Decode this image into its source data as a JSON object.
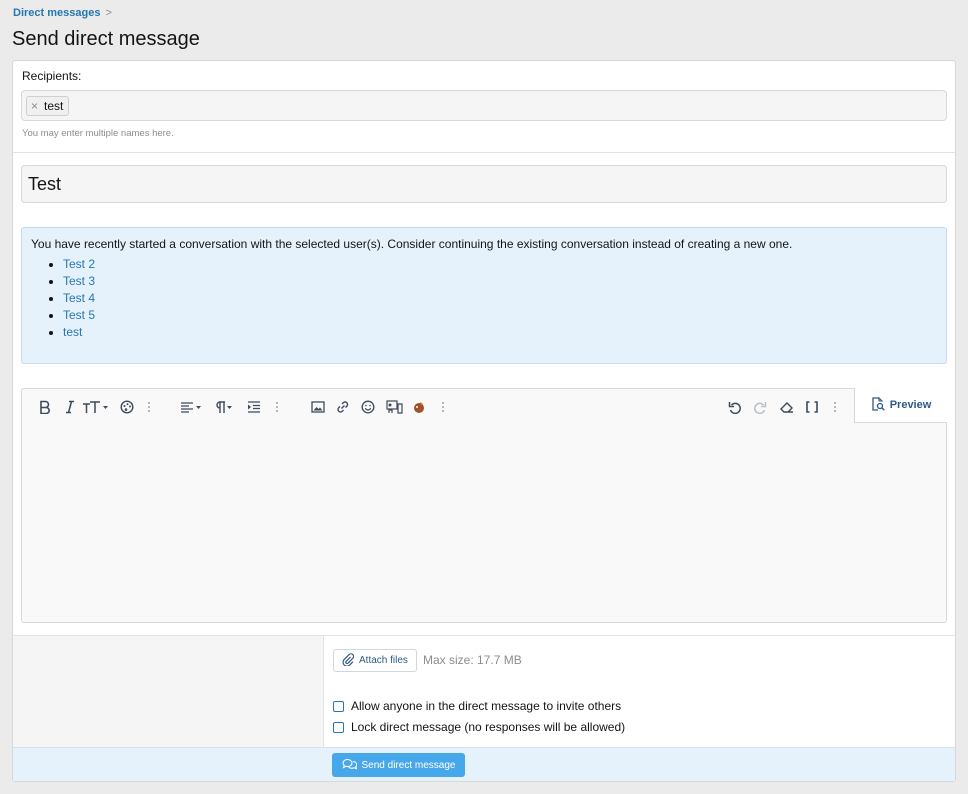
{
  "breadcrumb": {
    "item": "Direct messages",
    "separator": ">"
  },
  "page_title": "Send direct message",
  "recipients": {
    "label": "Recipients:",
    "tokens": [
      "test"
    ],
    "remove_glyph": "×",
    "hint": "You may enter multiple names here."
  },
  "title_field": {
    "value": "Test"
  },
  "notice": {
    "message": "You have recently started a conversation with the selected user(s). Consider continuing the existing conversation instead of creating a new one.",
    "links": [
      "Test 2",
      "Test 3",
      "Test 4",
      "Test 5",
      "test"
    ]
  },
  "editor": {
    "toolbar": [
      "bold-icon",
      "italic-icon",
      "text-size-icon",
      "text-color-icon",
      "more-icon",
      "align-icon",
      "paragraph-icon",
      "indent-icon",
      "more-icon",
      "image-icon",
      "link-icon",
      "emoji-icon",
      "media-icon",
      "gif-icon",
      "more-icon",
      "undo-icon",
      "redo-icon",
      "clear-format-icon",
      "bbcode-icon",
      "more-icon"
    ],
    "preview_label": "Preview",
    "body": ""
  },
  "attachments": {
    "button_label": "Attach files",
    "max_size": "Max size: 17.7 MB"
  },
  "options": {
    "allow_invite": "Allow anyone in the direct message to invite others",
    "lock": "Lock direct message (no responses will be allowed)"
  },
  "submit": {
    "label": "Send direct message"
  },
  "colors": {
    "link": "#2577b1",
    "primary_button": "#47a7eb",
    "notice_bg": "#e6f2fb",
    "page_bg": "#ebebeb"
  }
}
